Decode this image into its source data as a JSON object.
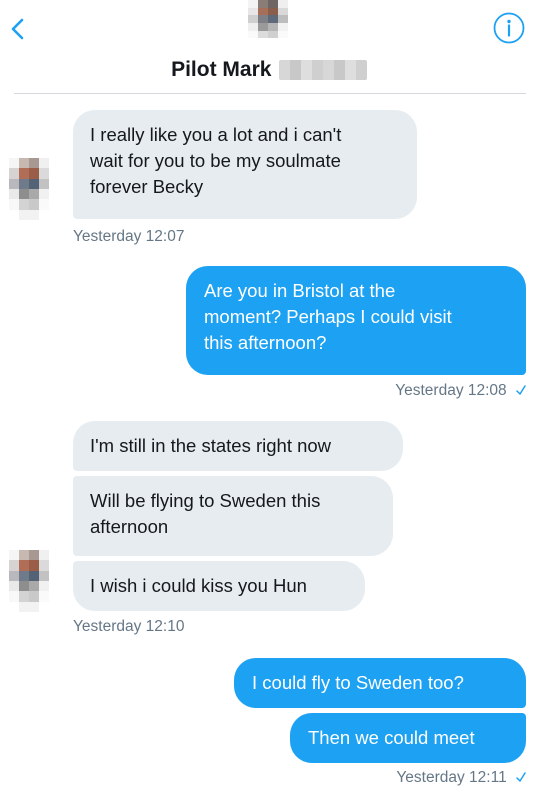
{
  "header": {
    "contact_name": "Pilot Mark",
    "back_icon": "chevron-left-icon",
    "info_icon": "info-icon",
    "accent_color": "#1da1f2"
  },
  "messages": [
    {
      "from": "contact",
      "text": [
        "I really like you a lot and i can't",
        "wait for you to be my soulmate",
        "forever Becky"
      ]
    },
    {
      "from": "contact",
      "timestamp": "Yesterday 12:07"
    },
    {
      "from": "me",
      "text": [
        "Are you in Bristol at the",
        "moment? Perhaps I could visit",
        "this afternoon?"
      ]
    },
    {
      "from": "me",
      "timestamp": "Yesterday 12:08"
    },
    {
      "from": "contact",
      "text": [
        "I'm still in the states right now"
      ]
    },
    {
      "from": "contact",
      "text": [
        "Will be flying to Sweden this",
        "afternoon"
      ]
    },
    {
      "from": "contact",
      "text": [
        "I wish i could kiss you Hun"
      ]
    },
    {
      "from": "contact",
      "timestamp": "Yesterday 12:10"
    },
    {
      "from": "me",
      "text": [
        "I could fly to Sweden too?"
      ]
    },
    {
      "from": "me",
      "text": [
        "Then we could meet"
      ]
    },
    {
      "from": "me",
      "timestamp": "Yesterday 12:11"
    }
  ]
}
